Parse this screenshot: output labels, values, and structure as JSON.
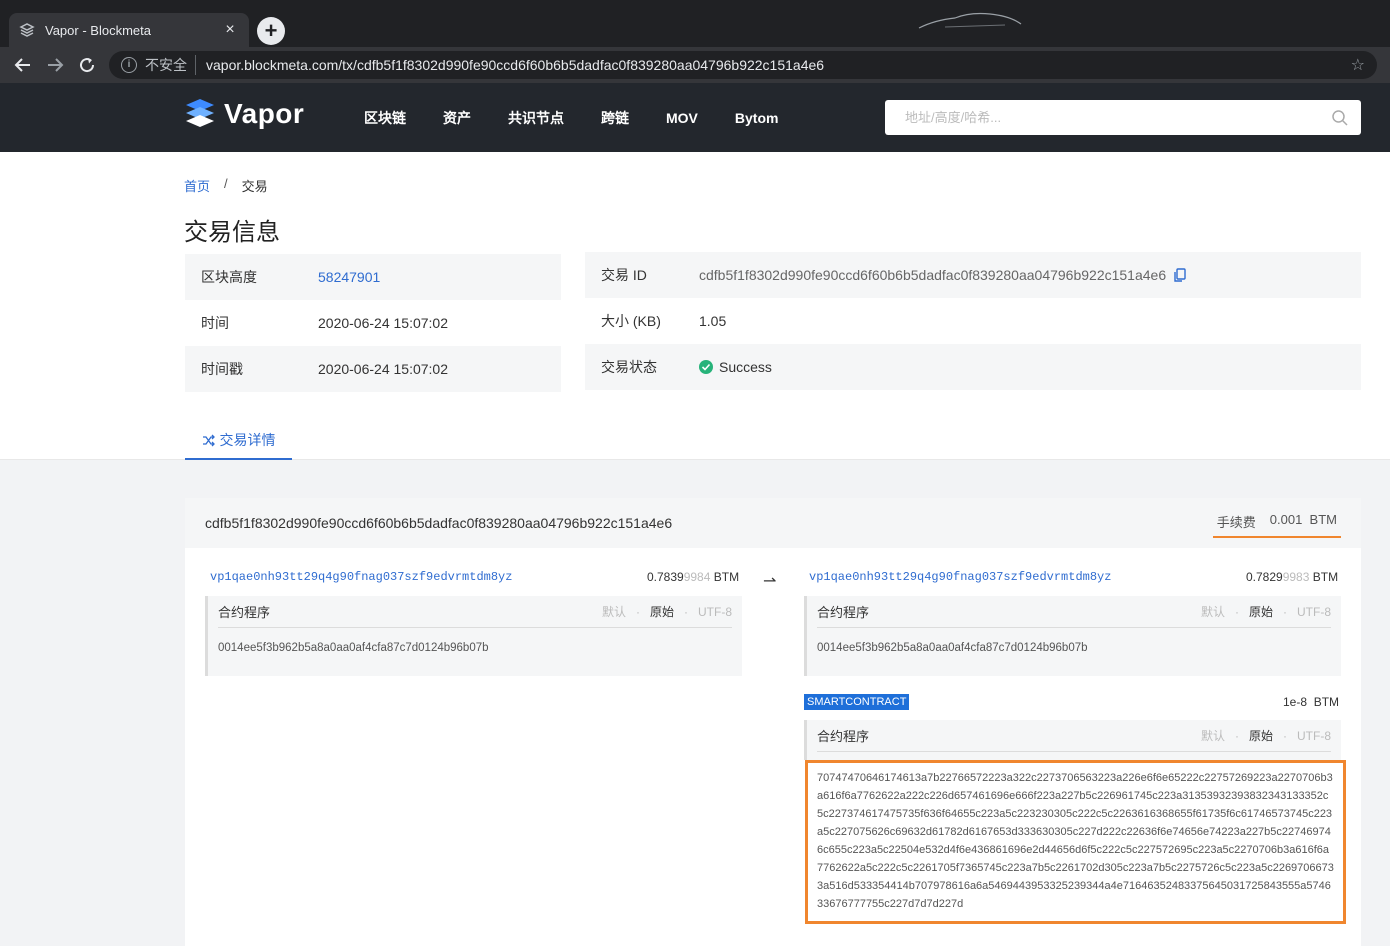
{
  "browser": {
    "tab_title": "Vapor - Blockmeta",
    "tab_close": "×",
    "new_tab": "+",
    "insecure_label": "不安全",
    "url": "vapor.blockmeta.com/tx/cdfb5f1f8302d990fe90ccd6f60b6b5dadfac0f839280aa04796b922c151a4e6"
  },
  "header": {
    "brand": "Vapor",
    "nav": [
      "区块链",
      "资产",
      "共识节点",
      "跨链",
      "MOV",
      "Bytom"
    ],
    "search_placeholder": "地址/高度/哈希..."
  },
  "breadcrumb": {
    "home": "首页",
    "sep": "/",
    "current": "交易"
  },
  "page_title": "交易信息",
  "info_left": [
    {
      "label": "区块高度",
      "value": "58247901"
    },
    {
      "label": "时间",
      "value": "2020-06-24 15:07:02"
    },
    {
      "label": "时间戳",
      "value": "2020-06-24 15:07:02"
    }
  ],
  "info_right": [
    {
      "label": "交易 ID",
      "value": "cdfb5f1f8302d990fe90ccd6f60b6b5dadfac0f839280aa04796b922c151a4e6"
    },
    {
      "label": "大小 (KB)",
      "value": "1.05"
    },
    {
      "label": "交易状态",
      "value": "Success"
    }
  ],
  "detail_tab": "交易详情",
  "tx": {
    "id": "cdfb5f1f8302d990fe90ccd6f60b6b5dadfac0f839280aa04796b922c151a4e6",
    "fee_label": "手续费",
    "fee_value": "0.001",
    "fee_unit": "BTM",
    "arrow": "⇀",
    "input": {
      "address": "vp1qae0nh93tt29q4g90fnag037szf9edvrmtdm8yz",
      "amount_main": "0.7839",
      "amount_dim": "9984",
      "unit": "BTM",
      "program_label": "合约程序",
      "opt_default": "默认",
      "opt_raw": "原始",
      "opt_utf8": "UTF-8",
      "dot": "·",
      "program": "0014ee5f3b962b5a8a0aa0af4cfa87c7d0124b96b07b"
    },
    "output1": {
      "address": "vp1qae0nh93tt29q4g90fnag037szf9edvrmtdm8yz",
      "amount_main": "0.7829",
      "amount_dim": "9983",
      "unit": "BTM",
      "program_label": "合约程序",
      "opt_default": "默认",
      "opt_raw": "原始",
      "opt_utf8": "UTF-8",
      "dot": "·",
      "program": "0014ee5f3b962b5a8a0aa0af4cfa87c7d0124b96b07b"
    },
    "output2": {
      "badge": "SMARTCONTRACT",
      "amount": "1e-8",
      "unit": "BTM",
      "program_label": "合约程序",
      "opt_default": "默认",
      "opt_raw": "原始",
      "opt_utf8": "UTF-8",
      "dot": "·",
      "program": "70747470646174613a7b22766572223a322c2273706563223a226e6f6e65222c22757269223a2270706b3a616f6a7762622a222c226d657461696e666f223a227b5c226961745c223a31353932393832343133352c5c227374617475735f636f64655c223a5c223230305c222c5c2263616368655f61735f6c61746573745c223a5c227075626c69632d61782d6167653d333630305c227d222c22636f6e74656e74223a227b5c227469746c655c223a5c22504e532d4f6e436861696e2d44656d6f5c222c5c227572695c223a5c2270706b3a616f6a7762622a5c222c5c2261705f7365745c223a7b5c2261702d305c223a7b5c2275726c5c223a5c22697066733a516d533354414b707978616a6a5469443953325239344a4e71646352483375645031725843555a574633676777755c227d7d7d227d"
    }
  },
  "colors": {
    "accent": "#2f6cd0",
    "highlight": "#f0862e",
    "header_bg": "#23272d",
    "success": "#27b37a"
  }
}
